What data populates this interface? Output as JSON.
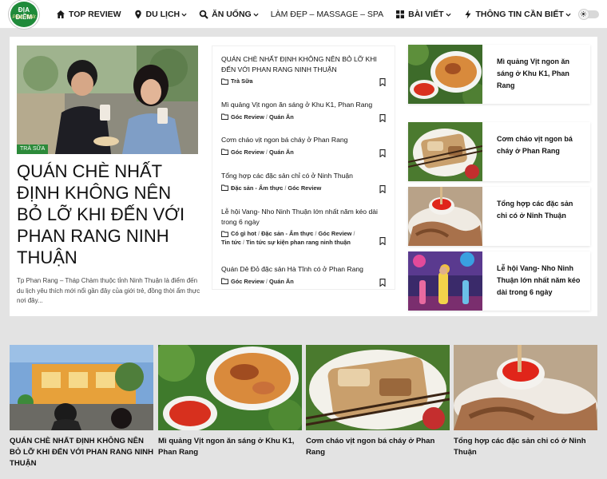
{
  "logo": {
    "line1": "ĐỊA ĐIỂM",
    "line2": "Phan Thiết"
  },
  "nav": [
    {
      "label": "TOP REVIEW",
      "icon": "home-icon",
      "dropdown": false
    },
    {
      "label": "DU LỊCH",
      "icon": "map-pin-icon",
      "dropdown": true
    },
    {
      "label": "ĂN UỐNG",
      "icon": "search-icon",
      "dropdown": true
    },
    {
      "label": "LÀM ĐẸP – MASSAGE – SPA",
      "icon": "",
      "dropdown": false
    },
    {
      "label": "BÀI VIẾT",
      "icon": "grid-icon",
      "dropdown": true
    },
    {
      "label": "THÔNG TIN CẦN BIẾT",
      "icon": "bolt-icon",
      "dropdown": true
    }
  ],
  "hero": {
    "tag": "TRÀ SỮA",
    "title": "QUÁN CHÈ NHẤT ĐỊNH KHÔNG NÊN BỎ LỠ KHI ĐẾN VỚI PHAN RANG NINH THUẬN",
    "excerpt": "Tp Phan Rang – Tháp Chàm thuộc tỉnh Ninh Thuận là điểm đến du lịch yêu thích mới nổi gần đây của giới trẻ, đồng thời ẩm thực nơi đây..."
  },
  "list": [
    {
      "title": "QUÁN CHÈ NHẤT ĐỊNH KHÔNG NÊN BỎ LỠ KHI ĐẾN VỚI PHAN RANG NINH THUẬN",
      "cats": [
        "Trà Sữa"
      ]
    },
    {
      "title": "Mì quảng Vịt ngon ăn sáng ở Khu K1, Phan Rang",
      "cats": [
        "Góc Review",
        "Quán Ăn"
      ]
    },
    {
      "title": "Cơm cháo vịt ngon bá cháy ở Phan Rang",
      "cats": [
        "Góc Review",
        "Quán Ăn"
      ]
    },
    {
      "title": "Tổng hợp các đặc sản chỉ có ở Ninh Thuận",
      "cats": [
        "Đặc sản - Ẩm thực",
        "Góc Review"
      ]
    },
    {
      "title": "Lễ hội Vang- Nho Ninh Thuận lớn nhất năm kéo dài trong 6 ngày",
      "cats": [
        "Có gì hot",
        "Đặc sản - Ẩm thực",
        "Góc Review",
        "Tin tức",
        "Tin tức sự kiện phan rang ninh thuận"
      ]
    },
    {
      "title": "Quán Dê Đỏ đặc sản Hà Tĩnh có ở Phan Rang",
      "cats": [
        "Góc Review",
        "Quán Ăn"
      ]
    }
  ],
  "side": [
    {
      "title": "Mì quảng Vịt ngon ăn sáng ở Khu K1, Phan Rang"
    },
    {
      "title": "Cơm cháo vịt ngon bá cháy ở Phan Rang"
    },
    {
      "title": "Tổng hợp các đặc sản chỉ có ở Ninh Thuận"
    },
    {
      "title": "Lễ hội Vang- Nho Ninh Thuận lớn nhất năm kéo dài trong 6 ngày"
    }
  ],
  "bottom": [
    {
      "title": "QUÁN CHÈ NHẤT ĐỊNH KHÔNG NÊN BỎ LỠ KHI ĐẾN VỚI PHAN RANG NINH THUẬN"
    },
    {
      "title": "Mì quảng Vịt ngon ăn sáng ở Khu K1, Phan Rang"
    },
    {
      "title": "Cơm cháo vịt ngon bá cháy ở Phan Rang"
    },
    {
      "title": "Tổng hợp các đặc sản chỉ có ở Ninh Thuận"
    }
  ],
  "colors": {
    "brand_green": "#2c8a3a",
    "panel_bg": "#ffffff",
    "page_bg": "#e3e3e3"
  }
}
